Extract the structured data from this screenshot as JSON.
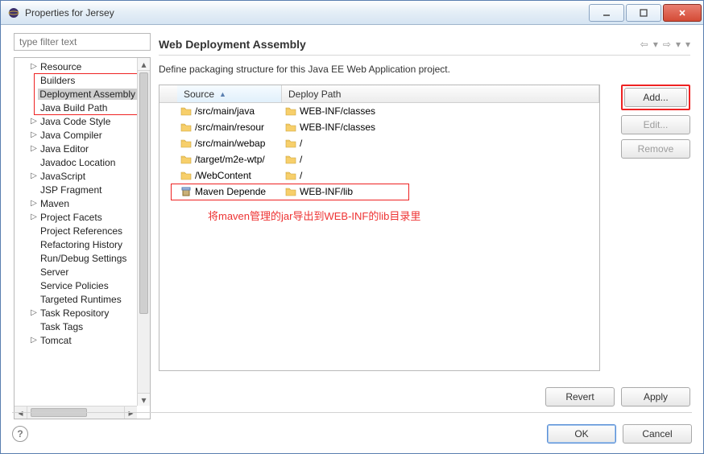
{
  "window": {
    "title": "Properties for Jersey"
  },
  "filter": {
    "placeholder": "type filter text"
  },
  "tree": {
    "items": [
      {
        "label": "Resource",
        "expandable": true
      },
      {
        "label": "Builders"
      },
      {
        "label": "Deployment Assembly",
        "selected": true
      },
      {
        "label": "Java Build Path"
      },
      {
        "label": "Java Code Style",
        "expandable": true
      },
      {
        "label": "Java Compiler",
        "expandable": true
      },
      {
        "label": "Java Editor",
        "expandable": true
      },
      {
        "label": "Javadoc Location"
      },
      {
        "label": "JavaScript",
        "expandable": true
      },
      {
        "label": "JSP Fragment"
      },
      {
        "label": "Maven",
        "expandable": true
      },
      {
        "label": "Project Facets",
        "expandable": true
      },
      {
        "label": "Project References"
      },
      {
        "label": "Refactoring History"
      },
      {
        "label": "Run/Debug Settings"
      },
      {
        "label": "Server"
      },
      {
        "label": "Service Policies"
      },
      {
        "label": "Targeted Runtimes"
      },
      {
        "label": "Task Repository",
        "expandable": true
      },
      {
        "label": "Task Tags"
      },
      {
        "label": "Tomcat",
        "expandable": true
      }
    ]
  },
  "main": {
    "title": "Web Deployment Assembly",
    "desc": "Define packaging structure for this Java EE Web Application project.",
    "columns": {
      "source": "Source",
      "deploy": "Deploy Path"
    },
    "rows": [
      {
        "icon": "folder",
        "source": "/src/main/java",
        "deployIcon": "folder",
        "deploy": "WEB-INF/classes"
      },
      {
        "icon": "folder",
        "source": "/src/main/resour",
        "deployIcon": "folder",
        "deploy": "WEB-INF/classes"
      },
      {
        "icon": "folder",
        "source": "/src/main/webap",
        "deployIcon": "folder",
        "deploy": "/"
      },
      {
        "icon": "folder",
        "source": "/target/m2e-wtp/",
        "deployIcon": "folder",
        "deploy": "/"
      },
      {
        "icon": "folder",
        "source": "/WebContent",
        "deployIcon": "folder",
        "deploy": "/"
      },
      {
        "icon": "jar",
        "source": "Maven Depende",
        "deployIcon": "folder",
        "deploy": "WEB-INF/lib"
      }
    ],
    "annotation": "将maven管理的jar导出到WEB-INF的lib目录里"
  },
  "buttons": {
    "add": "Add...",
    "edit": "Edit...",
    "remove": "Remove",
    "revert": "Revert",
    "apply": "Apply",
    "ok": "OK",
    "cancel": "Cancel"
  },
  "icons": {
    "nav_back": "⇦",
    "nav_fwd": "⇨",
    "nav_menu": "▾"
  }
}
